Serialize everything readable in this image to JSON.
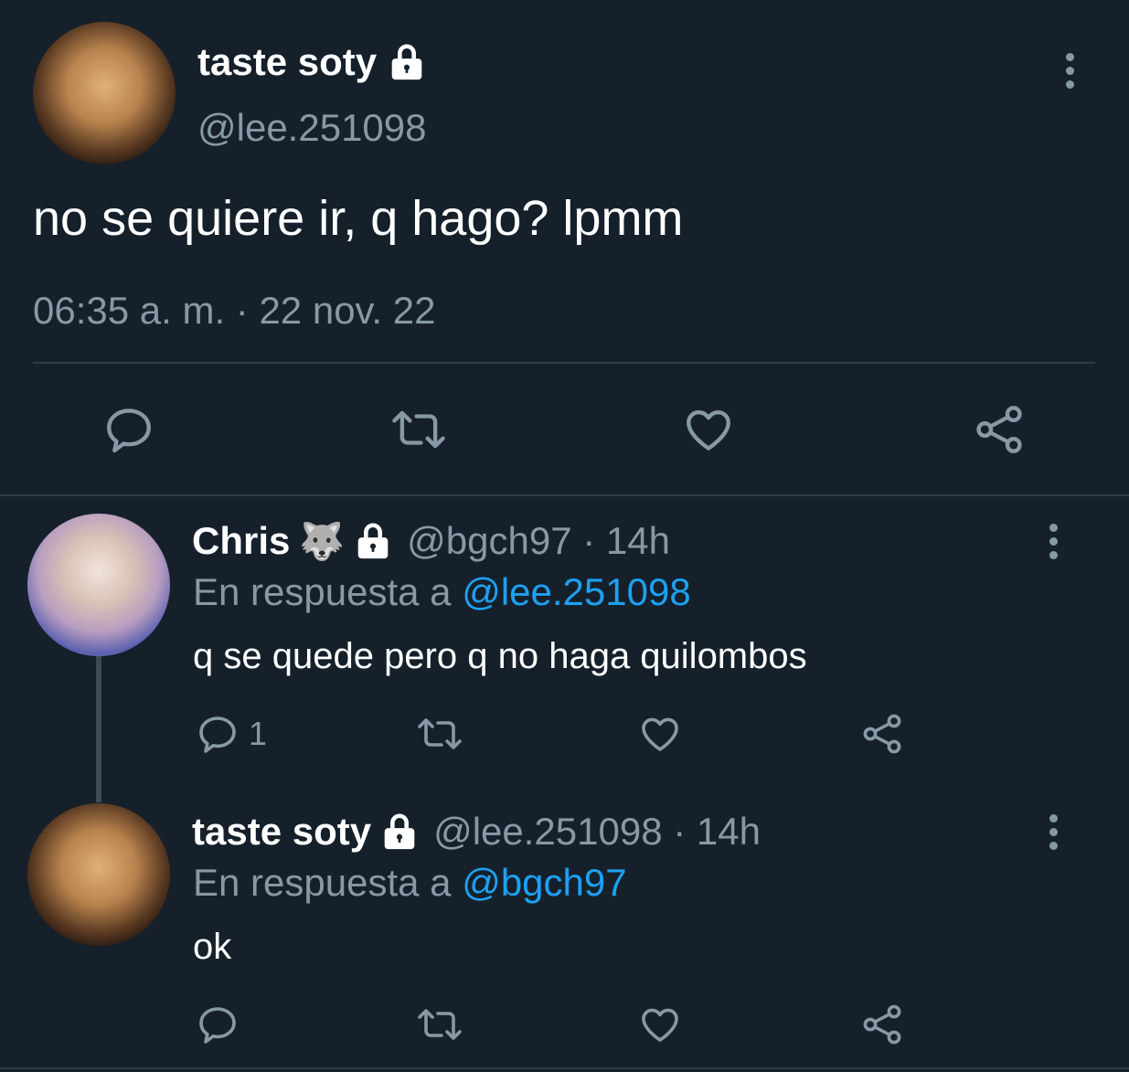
{
  "main_tweet": {
    "display_name": "taste soty",
    "handle": "@lee.251098",
    "text": "no se quiere ir, q hago? lpmm",
    "timestamp": "06:35 a. m. · 22 nov. 22"
  },
  "replies": [
    {
      "display_name": "Chris",
      "emoji": "🐺",
      "handle_time": "@bgch97 · 14h",
      "reply_prefix": "En respuesta a",
      "reply_to": "@lee.251098",
      "text": "q se quede pero q no haga quilombos",
      "reply_count": "1"
    },
    {
      "display_name": "taste soty",
      "handle_time": "@lee.251098 · 14h",
      "reply_prefix": "En respuesta a",
      "reply_to": "@bgch97",
      "text": "ok",
      "reply_count": ""
    }
  ],
  "icons": [
    "lock-icon",
    "more-options-icon",
    "reply-icon",
    "retweet-icon",
    "like-icon",
    "share-icon"
  ],
  "colors": {
    "background": "#15202b",
    "muted": "#8899a6",
    "link": "#1da1f2",
    "divider": "#2f3d4b"
  }
}
